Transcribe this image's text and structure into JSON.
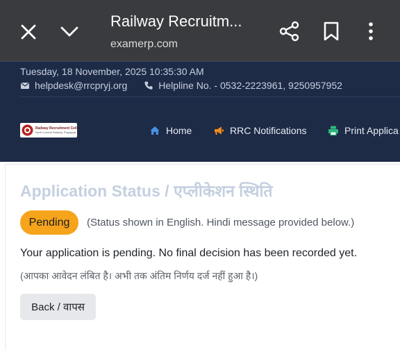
{
  "browser": {
    "title": "Railway Recruitm...",
    "url": "examerp.com",
    "icons": [
      "close-icon",
      "chevron-down-icon",
      "share-icon",
      "bookmark-icon",
      "more-vert-icon"
    ]
  },
  "header": {
    "datetime": "Tuesday, 18 November, 2025 10:35:30 AM",
    "email": "helpdesk@rrcpryj.org",
    "helpline": "Helpline No. - 0532-2223961, 9250957952",
    "logo_text_1": "Railway Recruitment Cell",
    "logo_text_2": "North Central Railway, Prayagraj",
    "nav": [
      {
        "label": "Home",
        "icon": "home-icon",
        "color": "#4a90e2"
      },
      {
        "label": "RRC Notifications",
        "icon": "megaphone-icon",
        "color": "#f08c1a"
      },
      {
        "label": "Print Applica",
        "icon": "printer-icon",
        "color": "#2eb67d"
      }
    ]
  },
  "main": {
    "title": "Application Status / एप्लीकेशन स्थिति",
    "status_badge": "Pending",
    "status_note": "(Status shown in English. Hindi message provided below.)",
    "message_en": "Your application is pending. No final decision has been recorded yet.",
    "message_hi": "(आपका आवेदन लंबित है। अभी तक अंतिम निर्णय दर्ज नहीं हुआ है।)",
    "back_label": "Back / वापस"
  },
  "colors": {
    "browser_bar": "#3a3b3e",
    "header_bg": "#1e2b47",
    "badge": "#f5a41c",
    "title": "#c4d0df"
  }
}
